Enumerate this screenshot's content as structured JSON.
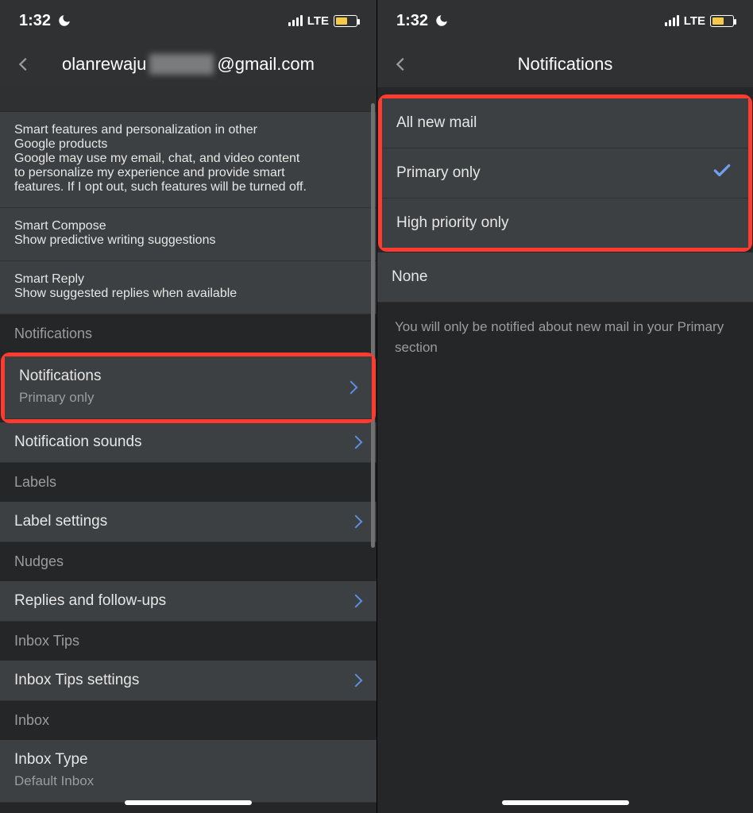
{
  "status": {
    "time": "1:32",
    "network": "LTE",
    "battery_color": "#f7c948",
    "battery_pct": 55
  },
  "left": {
    "title_prefix": "olanrewaju",
    "title_blur": "xxxxxxx",
    "title_suffix": "@gmail.com",
    "truncated_top": "…",
    "smart_features": {
      "title": "Smart features and personalization in other Google products",
      "desc": "Google may use my email, chat, and video content to personalize my experience and provide smart features. If I opt out, such features will be turned off."
    },
    "smart_compose": {
      "title": "Smart Compose",
      "sub": "Show predictive writing suggestions"
    },
    "smart_reply": {
      "title": "Smart Reply",
      "sub": "Show suggested replies when available"
    },
    "section_notifications": "Notifications",
    "notifications_row": {
      "title": "Notifications",
      "sub": "Primary only"
    },
    "notification_sounds": "Notification sounds",
    "section_labels": "Labels",
    "label_settings": "Label settings",
    "section_nudges": "Nudges",
    "replies": "Replies and follow-ups",
    "section_inbox_tips": "Inbox Tips",
    "inbox_tips_settings": "Inbox Tips settings",
    "section_inbox": "Inbox",
    "inbox_type": {
      "title": "Inbox Type",
      "sub": "Default Inbox"
    }
  },
  "right": {
    "title": "Notifications",
    "options": {
      "all": "All new mail",
      "primary": "Primary only",
      "high": "High priority only",
      "none": "None"
    },
    "helper": "You will only be notified about new mail in your Primary section"
  }
}
